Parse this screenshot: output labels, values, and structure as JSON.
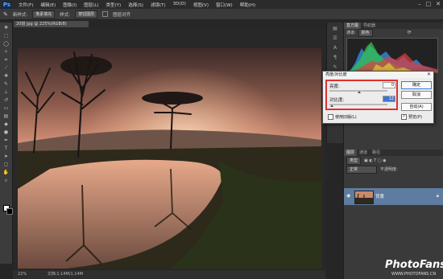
{
  "menubar": {
    "logo": "Ps",
    "items": [
      "文件(F)",
      "编辑(E)",
      "图像(I)",
      "图层(L)",
      "类型(Y)",
      "选择(S)",
      "滤镜(T)",
      "3D(D)",
      "视图(V)",
      "窗口(W)",
      "帮助(H)"
    ]
  },
  "options_bar": {
    "width_label": "新样式:",
    "width_value": "像素填充",
    "style_label": "样式:",
    "style_value": "按钮图层",
    "toggle_label": "图层对齐"
  },
  "document": {
    "tab_label": "20班 jpg @ 225%(RGB/8)",
    "zoom": "22%",
    "doc_info": "文档:1.14M/1.14M"
  },
  "panels": {
    "top_tabs": [
      "直方图",
      "导航器"
    ],
    "channel_label": "通道:",
    "channel_value": "颜色",
    "layer_tabs": [
      "图层",
      "通道",
      "路径"
    ],
    "layer_kind": "类型",
    "blend_mode": "正常",
    "opacity_label": "不透明度:",
    "layer_name": "背景"
  },
  "dialog": {
    "title": "亮度/对比度",
    "brightness_label": "亮度:",
    "brightness_value": "0",
    "contrast_label": "对比度:",
    "contrast_value": "12",
    "ok_label": "确定",
    "cancel_label": "取消",
    "auto_label": "自动(A)",
    "legacy_label": "使用旧版(L)",
    "preview_label": "预览(P)",
    "preview_checked": true,
    "legacy_checked": false
  },
  "watermark": {
    "brand": "PhotoFans",
    "url": "WWW.PHOTOFANS.CN"
  },
  "colors": {
    "accent": "#e03030",
    "layer_selected": "#5e7ba0"
  }
}
